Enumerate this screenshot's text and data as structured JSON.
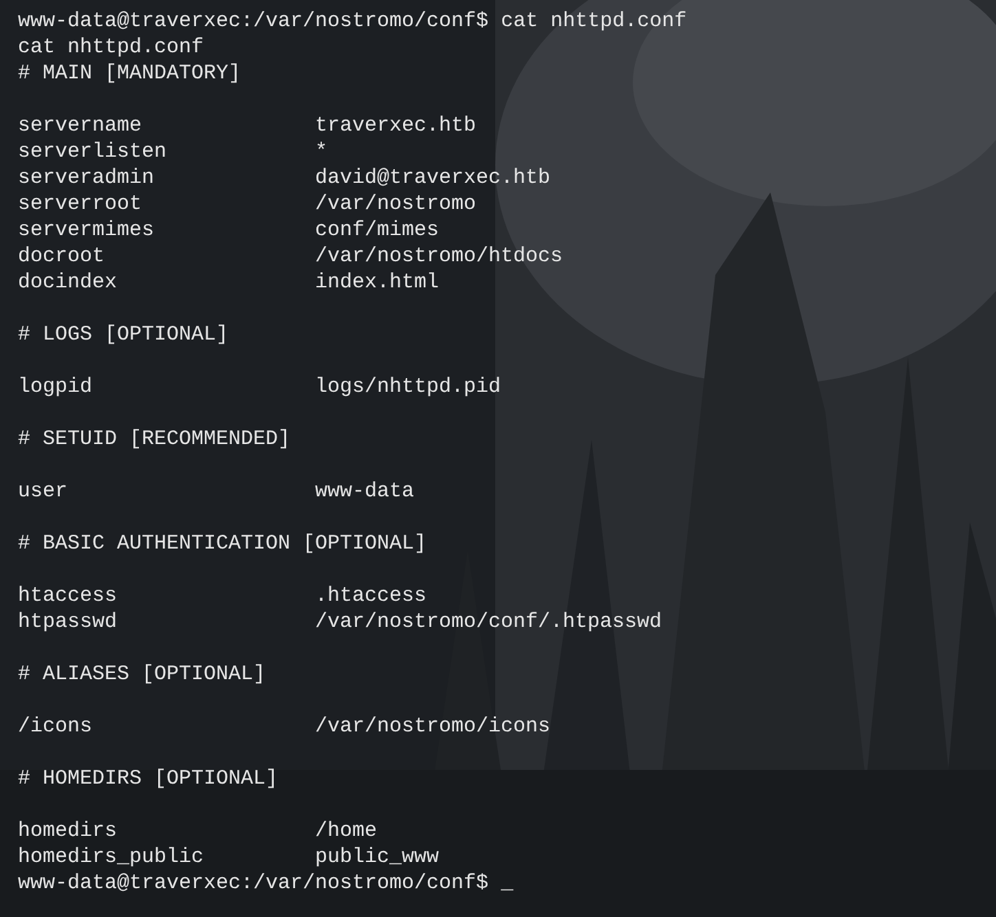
{
  "terminal": {
    "lines": [
      {
        "kind": "prompt",
        "prompt": "www-data@traverxec:/var/nostromo/conf$",
        "command": "cat nhttpd.conf"
      },
      {
        "kind": "output",
        "text": "cat nhttpd.conf"
      },
      {
        "kind": "output",
        "text": "# MAIN [MANDATORY]"
      },
      {
        "kind": "blank"
      },
      {
        "kind": "setting",
        "key": "servername",
        "value": "traverxec.htb"
      },
      {
        "kind": "setting",
        "key": "serverlisten",
        "value": "*"
      },
      {
        "kind": "setting",
        "key": "serveradmin",
        "value": "david@traverxec.htb"
      },
      {
        "kind": "setting",
        "key": "serverroot",
        "value": "/var/nostromo"
      },
      {
        "kind": "setting",
        "key": "servermimes",
        "value": "conf/mimes"
      },
      {
        "kind": "setting",
        "key": "docroot",
        "value": "/var/nostromo/htdocs"
      },
      {
        "kind": "setting",
        "key": "docindex",
        "value": "index.html"
      },
      {
        "kind": "blank"
      },
      {
        "kind": "output",
        "text": "# LOGS [OPTIONAL]"
      },
      {
        "kind": "blank"
      },
      {
        "kind": "setting",
        "key": "logpid",
        "value": "logs/nhttpd.pid"
      },
      {
        "kind": "blank"
      },
      {
        "kind": "output",
        "text": "# SETUID [RECOMMENDED]"
      },
      {
        "kind": "blank"
      },
      {
        "kind": "setting",
        "key": "user",
        "value": "www-data"
      },
      {
        "kind": "blank"
      },
      {
        "kind": "output",
        "text": "# BASIC AUTHENTICATION [OPTIONAL]"
      },
      {
        "kind": "blank"
      },
      {
        "kind": "setting",
        "key": "htaccess",
        "value": ".htaccess"
      },
      {
        "kind": "setting",
        "key": "htpasswd",
        "value": "/var/nostromo/conf/.htpasswd"
      },
      {
        "kind": "blank"
      },
      {
        "kind": "output",
        "text": "# ALIASES [OPTIONAL]"
      },
      {
        "kind": "blank"
      },
      {
        "kind": "setting",
        "key": "/icons",
        "value": "/var/nostromo/icons"
      },
      {
        "kind": "blank"
      },
      {
        "kind": "output",
        "text": "# HOMEDIRS [OPTIONAL]"
      },
      {
        "kind": "blank"
      },
      {
        "kind": "setting",
        "key": "homedirs",
        "value": "/home"
      },
      {
        "kind": "setting",
        "key": "homedirs_public",
        "value": "public_www"
      },
      {
        "kind": "prompt",
        "prompt": "www-data@traverxec:/var/nostromo/conf$",
        "cursor": "_"
      }
    ]
  }
}
